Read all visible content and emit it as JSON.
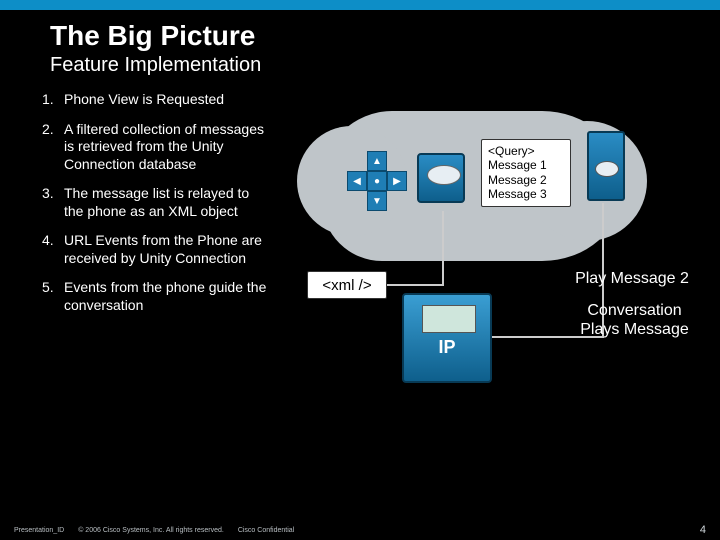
{
  "header": {
    "title": "The Big Picture",
    "subtitle": "Feature Implementation"
  },
  "steps": [
    {
      "n": "1.",
      "text": "Phone View is Requested"
    },
    {
      "n": "2.",
      "text": "A filtered collection of messages is retrieved from the Unity Connection database"
    },
    {
      "n": "3.",
      "text": "The message list is relayed to the phone as an XML object"
    },
    {
      "n": "4.",
      "text": "URL Events from the Phone are received by Unity Connection"
    },
    {
      "n": "5.",
      "text": "Events from the phone guide the conversation"
    }
  ],
  "diagram": {
    "query_header": "<Query>",
    "query_lines": [
      "Message 1",
      "Message 2",
      "Message 3"
    ],
    "xml": "<xml />",
    "ip_label": "IP",
    "play_label": "Play Message 2",
    "conv_label_l1": "Conversation",
    "conv_label_l2": "Plays Message"
  },
  "footer": {
    "presentation_id": "Presentation_ID",
    "copyright": "© 2006 Cisco Systems, Inc. All rights reserved.",
    "confidential": "Cisco Confidential",
    "page": "4"
  }
}
